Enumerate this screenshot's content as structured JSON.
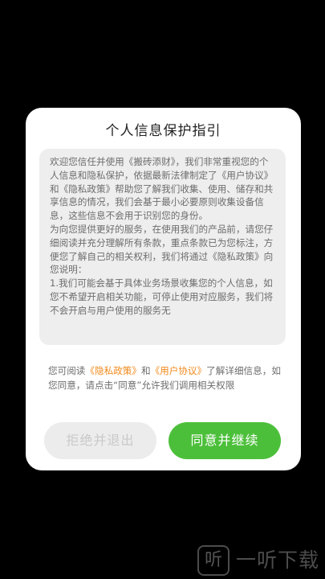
{
  "dialog": {
    "title": "个人信息保护指引",
    "body_text": "欢迎您信任并使用《搬砖添财》，我们非常重视您的个人信息和隐私保护，依据最新法律制定了《用户协议》和《隐私政策》帮助您了解我们收集、使用、储存和共享信息的情况，我们会基于最小必要原则收集设备信息，这些信息不会用于识别您的身份。\n为向您提供更好的服务，在使用我们的产品前，请您仔细阅读并充分理解所有条款，重点条款已为您标注，方便您了解自己的相关权利，我们将通过《隐私政策》向您说明：\n1.我们可能会基于具体业务场景收集您的个人信息，如您不希望开启相关功能，可停止使用对应服务，我们将不会开启与用户使用的服务无",
    "notice": {
      "prefix": "您可阅读",
      "privacy_link": "《隐私政策》",
      "and": "和",
      "agreement_link": "《用户协议》",
      "suffix": "了解详细信息，如您同意，请点击“同意”允许我们调用相关权限"
    },
    "refuse_button": "拒绝并退出",
    "agree_button": "同意并继续"
  },
  "watermark": {
    "logo_glyph": "听",
    "text": "一听下载"
  },
  "colors": {
    "background": "#000000",
    "dialog": "#ffffff",
    "scroll_box": "#eeeeee",
    "link": "#f28a1c",
    "agree_button": "#4cbf3a",
    "refuse_button": "#ececec"
  }
}
